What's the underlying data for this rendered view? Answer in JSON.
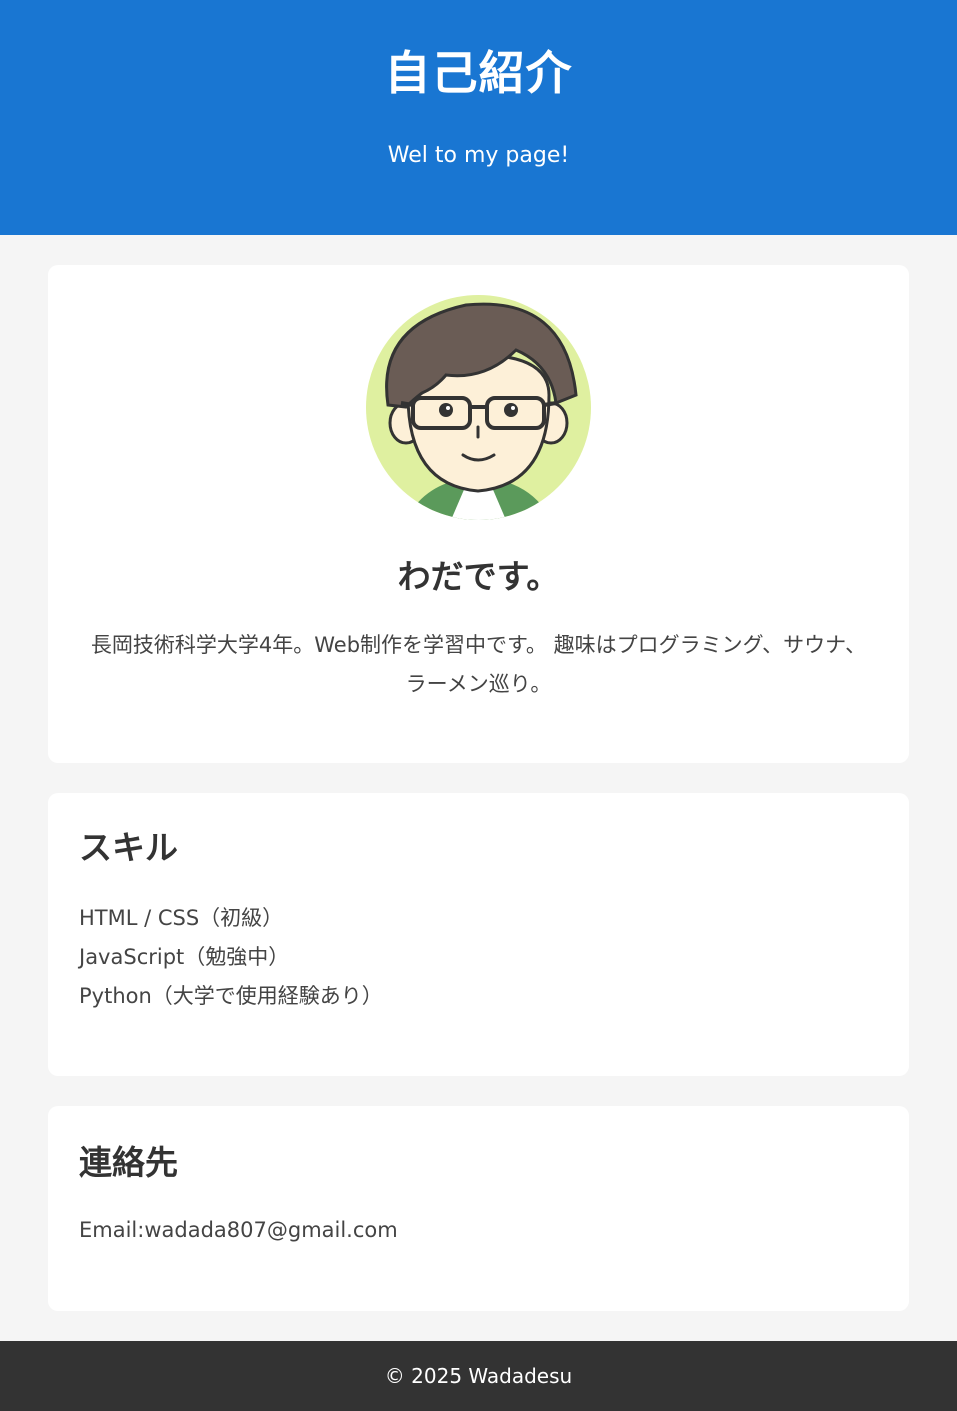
{
  "header": {
    "title": "自己紹介",
    "subtitle": "Wel to my page!"
  },
  "profile": {
    "avatar_icon": "avatar-illustration",
    "name": "わだです。",
    "description": "長岡技術科学大学4年。Web制作を学習中です。 趣味はプログラミング、サウナ、ラーメン巡り。"
  },
  "skills": {
    "heading": "スキル",
    "items": [
      "HTML / CSS（初級）",
      "JavaScript（勉強中）",
      "Python（大学で使用経験あり）"
    ]
  },
  "contact": {
    "heading": "連絡先",
    "email": "Email:wadada807@gmail.com"
  },
  "footer": {
    "text": "© 2025 Wadadesu"
  },
  "colors": {
    "header_bg": "#1976d2",
    "page_bg": "#f5f5f5",
    "card_bg": "#ffffff",
    "footer_bg": "#333333"
  }
}
